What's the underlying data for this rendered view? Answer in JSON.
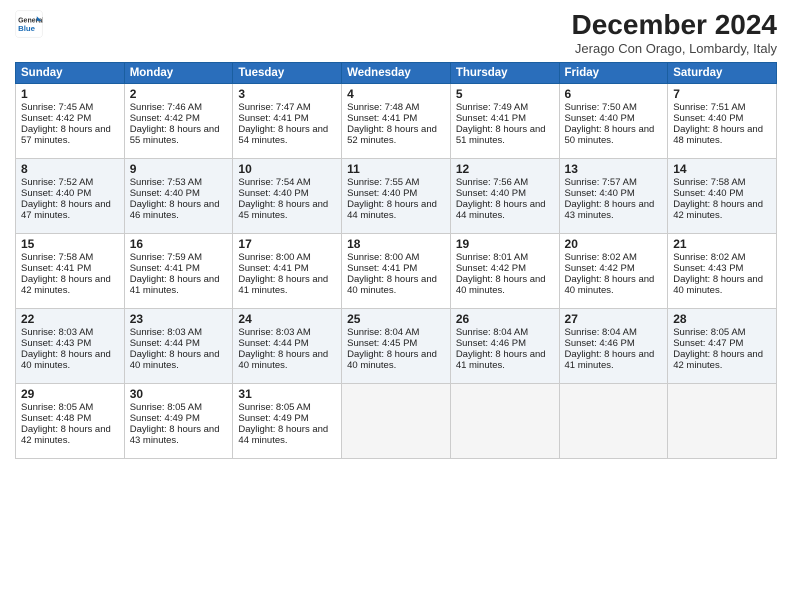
{
  "logo": {
    "line1": "General",
    "line2": "Blue"
  },
  "title": "December 2024",
  "location": "Jerago Con Orago, Lombardy, Italy",
  "headers": [
    "Sunday",
    "Monday",
    "Tuesday",
    "Wednesday",
    "Thursday",
    "Friday",
    "Saturday"
  ],
  "weeks": [
    [
      {
        "day": "1",
        "sunrise": "7:45 AM",
        "sunset": "4:42 PM",
        "daylight": "8 hours and 57 minutes."
      },
      {
        "day": "2",
        "sunrise": "7:46 AM",
        "sunset": "4:42 PM",
        "daylight": "8 hours and 55 minutes."
      },
      {
        "day": "3",
        "sunrise": "7:47 AM",
        "sunset": "4:41 PM",
        "daylight": "8 hours and 54 minutes."
      },
      {
        "day": "4",
        "sunrise": "7:48 AM",
        "sunset": "4:41 PM",
        "daylight": "8 hours and 52 minutes."
      },
      {
        "day": "5",
        "sunrise": "7:49 AM",
        "sunset": "4:41 PM",
        "daylight": "8 hours and 51 minutes."
      },
      {
        "day": "6",
        "sunrise": "7:50 AM",
        "sunset": "4:40 PM",
        "daylight": "8 hours and 50 minutes."
      },
      {
        "day": "7",
        "sunrise": "7:51 AM",
        "sunset": "4:40 PM",
        "daylight": "8 hours and 48 minutes."
      }
    ],
    [
      {
        "day": "8",
        "sunrise": "7:52 AM",
        "sunset": "4:40 PM",
        "daylight": "8 hours and 47 minutes."
      },
      {
        "day": "9",
        "sunrise": "7:53 AM",
        "sunset": "4:40 PM",
        "daylight": "8 hours and 46 minutes."
      },
      {
        "day": "10",
        "sunrise": "7:54 AM",
        "sunset": "4:40 PM",
        "daylight": "8 hours and 45 minutes."
      },
      {
        "day": "11",
        "sunrise": "7:55 AM",
        "sunset": "4:40 PM",
        "daylight": "8 hours and 44 minutes."
      },
      {
        "day": "12",
        "sunrise": "7:56 AM",
        "sunset": "4:40 PM",
        "daylight": "8 hours and 44 minutes."
      },
      {
        "day": "13",
        "sunrise": "7:57 AM",
        "sunset": "4:40 PM",
        "daylight": "8 hours and 43 minutes."
      },
      {
        "day": "14",
        "sunrise": "7:58 AM",
        "sunset": "4:40 PM",
        "daylight": "8 hours and 42 minutes."
      }
    ],
    [
      {
        "day": "15",
        "sunrise": "7:58 AM",
        "sunset": "4:41 PM",
        "daylight": "8 hours and 42 minutes."
      },
      {
        "day": "16",
        "sunrise": "7:59 AM",
        "sunset": "4:41 PM",
        "daylight": "8 hours and 41 minutes."
      },
      {
        "day": "17",
        "sunrise": "8:00 AM",
        "sunset": "4:41 PM",
        "daylight": "8 hours and 41 minutes."
      },
      {
        "day": "18",
        "sunrise": "8:00 AM",
        "sunset": "4:41 PM",
        "daylight": "8 hours and 40 minutes."
      },
      {
        "day": "19",
        "sunrise": "8:01 AM",
        "sunset": "4:42 PM",
        "daylight": "8 hours and 40 minutes."
      },
      {
        "day": "20",
        "sunrise": "8:02 AM",
        "sunset": "4:42 PM",
        "daylight": "8 hours and 40 minutes."
      },
      {
        "day": "21",
        "sunrise": "8:02 AM",
        "sunset": "4:43 PM",
        "daylight": "8 hours and 40 minutes."
      }
    ],
    [
      {
        "day": "22",
        "sunrise": "8:03 AM",
        "sunset": "4:43 PM",
        "daylight": "8 hours and 40 minutes."
      },
      {
        "day": "23",
        "sunrise": "8:03 AM",
        "sunset": "4:44 PM",
        "daylight": "8 hours and 40 minutes."
      },
      {
        "day": "24",
        "sunrise": "8:03 AM",
        "sunset": "4:44 PM",
        "daylight": "8 hours and 40 minutes."
      },
      {
        "day": "25",
        "sunrise": "8:04 AM",
        "sunset": "4:45 PM",
        "daylight": "8 hours and 40 minutes."
      },
      {
        "day": "26",
        "sunrise": "8:04 AM",
        "sunset": "4:46 PM",
        "daylight": "8 hours and 41 minutes."
      },
      {
        "day": "27",
        "sunrise": "8:04 AM",
        "sunset": "4:46 PM",
        "daylight": "8 hours and 41 minutes."
      },
      {
        "day": "28",
        "sunrise": "8:05 AM",
        "sunset": "4:47 PM",
        "daylight": "8 hours and 42 minutes."
      }
    ],
    [
      {
        "day": "29",
        "sunrise": "8:05 AM",
        "sunset": "4:48 PM",
        "daylight": "8 hours and 42 minutes."
      },
      {
        "day": "30",
        "sunrise": "8:05 AM",
        "sunset": "4:49 PM",
        "daylight": "8 hours and 43 minutes."
      },
      {
        "day": "31",
        "sunrise": "8:05 AM",
        "sunset": "4:49 PM",
        "daylight": "8 hours and 44 minutes."
      },
      null,
      null,
      null,
      null
    ]
  ]
}
